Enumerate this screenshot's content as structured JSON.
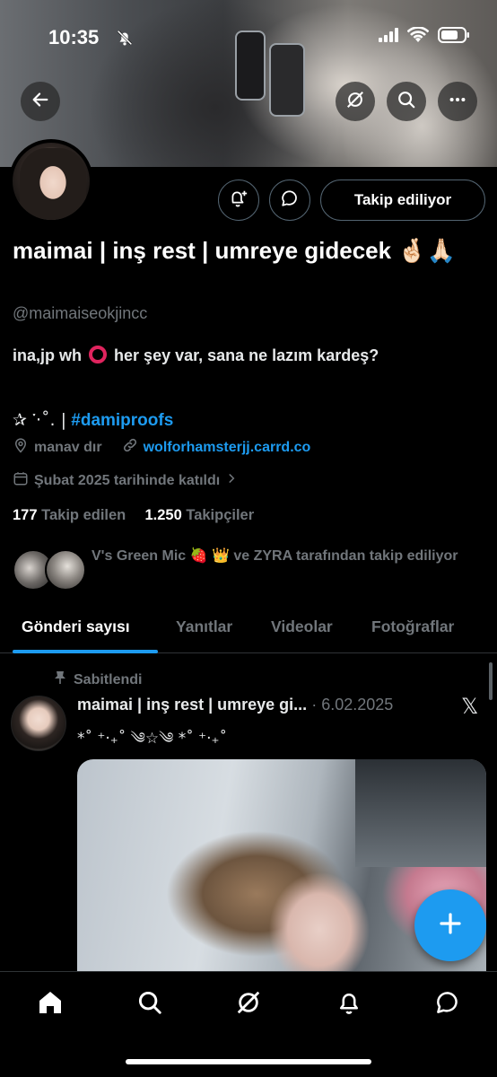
{
  "status_bar": {
    "time": "10:35"
  },
  "profile": {
    "display_name": "maimai | inş rest | umreye gidecek 🤞🏻🙏🏻",
    "handle": "@maimaiseokjincc",
    "bio_line1_before": "ina,jp wh",
    "bio_line1_after": "her şey var, sana ne lazım kardeş?",
    "bio_line2_symbols": "✰ ་‧˚. |",
    "bio_line2_tag": "#damiproofs",
    "location": "manav dır",
    "website": "wolforhamsterjj.carrd.co",
    "joined": "Şubat 2025 tarihinde katıldı",
    "following_count": "177",
    "following_label": "Takip edilen",
    "followers_count": "1.250",
    "followers_label": "Takipçiler",
    "followed_by": "V's Green Mic 🍓 👑 ve ZYRA tarafından takip ediliyor",
    "follow_button_label": "Takip ediliyor"
  },
  "tabs": [
    {
      "label": "Gönderi sayısı",
      "active": true
    },
    {
      "label": "Yanıtlar",
      "active": false
    },
    {
      "label": "Videolar",
      "active": false
    },
    {
      "label": "Fotoğraflar",
      "active": false
    }
  ],
  "pinned_post": {
    "pinned_label": "Sabitlendi",
    "author": "maimai | inş rest | umreye gi...",
    "date": "· 6.02.2025",
    "text": "*˚ ⁺‧₊˚ ༄☆༄ *˚ ⁺‧₊˚"
  },
  "icons": {
    "back": "back-arrow-icon",
    "grok": "grok-icon",
    "search": "search-icon",
    "more": "more-icon",
    "notify": "bell-plus-icon",
    "message": "message-icon",
    "location": "location-icon",
    "link": "link-icon",
    "calendar": "calendar-icon",
    "pin": "pin-icon",
    "compose": "plus-icon"
  },
  "colors": {
    "accent": "#1d9bf0",
    "background": "#000000",
    "muted": "#71767b"
  }
}
